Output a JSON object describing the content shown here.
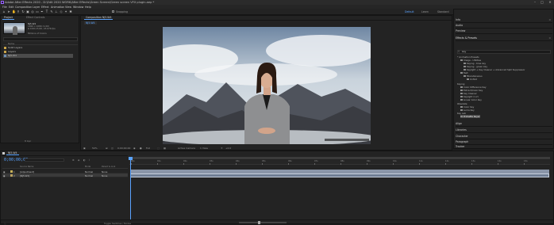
{
  "titlebar": {
    "title": "Adobe After Effects 2020 - D:\\Edit 2020 WORK\\After Effects\\Green Screen\\Green screen VFX plugin.aep *",
    "minimize": "–",
    "maximize": "□",
    "close": "✕"
  },
  "menu": [
    "File",
    "Edit",
    "Composition",
    "Layer",
    "Effect",
    "Animation",
    "View",
    "Window",
    "Help"
  ],
  "toolbar": {
    "snapping_label": "Snapping",
    "workspaces": [
      "Default",
      "Learn",
      "Standard",
      "Small Screen",
      "Libraries"
    ],
    "search_placeholder": "Search Help"
  },
  "project": {
    "tab_label": "Project",
    "tab2_label": "Effect Controls",
    "comp_name": "NJ5-W4",
    "comp_size": "1920 x 1080 (1.00)",
    "comp_duration": "Δ 0;00;15;00, 23.976 fps",
    "comp_info": "Millions of Colors",
    "col_name": "Name",
    "items": [
      {
        "name": "Solid Layers",
        "type": "folder"
      },
      {
        "name": "Layers",
        "type": "folder"
      },
      {
        "name": "NJ5-W4",
        "type": "comp",
        "selected": true
      }
    ],
    "bpc": "8 bpc"
  },
  "viewer": {
    "tab_label": "Composition NJ5-W4",
    "sub_tab": "NJ5-W4",
    "zoom": "50%",
    "timecode": "0;00;00;00",
    "resolution": "Full",
    "camera": "Active Camera",
    "views": "1 View",
    "exposure": "+0.0"
  },
  "right_panels": {
    "info": "Info",
    "audio": "Audio",
    "preview": "Preview",
    "effects_presets": "Effects & Presets",
    "effects_search": "key",
    "tree": [
      {
        "label": "* Animation Presets",
        "indent": 0
      },
      {
        "label": "Image - Utilities",
        "indent": 1
      },
      {
        "label": "Keying - blue key",
        "indent": 2
      },
      {
        "label": "Keying - green key",
        "indent": 2
      },
      {
        "label": "Keylight + Key Cleaner + Advanced Spill Suppressor",
        "indent": 2
      },
      {
        "label": "Text",
        "indent": 1
      },
      {
        "label": "Miscellaneous",
        "indent": 2
      },
      {
        "label": "Unfold",
        "indent": 2
      },
      {
        "label": "Keying",
        "indent": 0
      },
      {
        "label": "Color Difference Key",
        "indent": 1
      },
      {
        "label": "Extract/Color Key",
        "indent": 1
      },
      {
        "label": "Key Cleaner",
        "indent": 1
      },
      {
        "label": "Keylight (1.2)",
        "indent": 1
      },
      {
        "label": "Linear Color Key",
        "indent": 1
      },
      {
        "label": "Obsolete",
        "indent": 0
      },
      {
        "label": "Color Key",
        "indent": 1
      },
      {
        "label": "Luma Key",
        "indent": 1
      },
      {
        "label": "Key Lab",
        "indent": 0
      },
      {
        "label": "Primatte Keyer",
        "indent": 1,
        "selected": true
      }
    ],
    "align": "Align",
    "libraries": "Libraries",
    "character": "Character",
    "paragraph": "Paragraph",
    "tracker": "Tracker"
  },
  "timeline": {
    "tab_label": "NJ5-W4",
    "timecode": "0;00;00;00",
    "col_source": "Source Name",
    "col_mode": "Mode",
    "col_parent": "Parent & Link",
    "layers": [
      {
        "num": "1",
        "name": "[Adjustment]",
        "color": "#c8b25a",
        "mode": "Normal",
        "parent": "None"
      },
      {
        "num": "2",
        "name": "[NJ5-W4]",
        "color": "#b8a060",
        "mode": "Normal",
        "parent": "None",
        "selected": true
      }
    ],
    "ruler": [
      "00s",
      "01s",
      "02s",
      "03s",
      "04s",
      "05s",
      "06s",
      "07s",
      "08s",
      "09s",
      "10s",
      "11s",
      "12s",
      "13s",
      "14s",
      "15s"
    ],
    "toggle_label": "Toggle Switches / Modes"
  }
}
